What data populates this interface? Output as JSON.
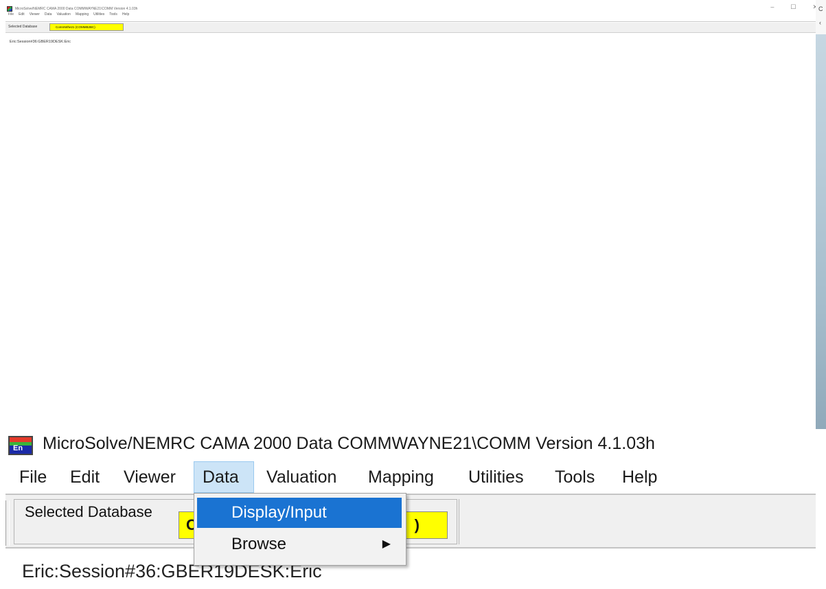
{
  "small_window": {
    "title": "MicroSolve/NEMRC CAMA 2000 Data COMMWAYNE21\\COMM Version 4.1.03h",
    "menu": [
      "File",
      "Edit",
      "Viewer",
      "Data",
      "Valuation",
      "Mapping",
      "Utilities",
      "Tools",
      "Help"
    ],
    "selected_database_label": "Selected Database",
    "database_value": "CommWhe21 (COMMB2BC)",
    "session": "Eric:Session#36:GBER19DESK:Eric",
    "window_controls": {
      "minimize": "–",
      "maximize": "☐",
      "close": "✕"
    }
  },
  "edge_glyphs": [
    "C",
    "‹"
  ],
  "big_window": {
    "logo_letters": "En",
    "title": "MicroSolve/NEMRC CAMA 2000  Data COMMWAYNE21\\COMM Version 4.1.03h",
    "menu": {
      "file": "File",
      "edit": "Edit",
      "viewer": "Viewer",
      "data": "Data",
      "valuation": "Valuation",
      "mapping": "Mapping",
      "utilities": "Utilities",
      "tools": "Tools",
      "help": "Help"
    },
    "selected_database_label": "Selected Database",
    "database_value_start": "C",
    "database_value_end": ")",
    "session": "Eric:Session#36:GBER19DESK:Eric"
  },
  "dropdown": {
    "items": [
      {
        "label": "Display/Input",
        "highlighted": true
      },
      {
        "label": "Browse",
        "submenu_icon": "triangle-right-icon"
      }
    ]
  },
  "colors": {
    "database_highlight": "#ffff00",
    "menu_active_bg": "#cce4f7",
    "dropdown_highlight": "#1a73d2"
  }
}
